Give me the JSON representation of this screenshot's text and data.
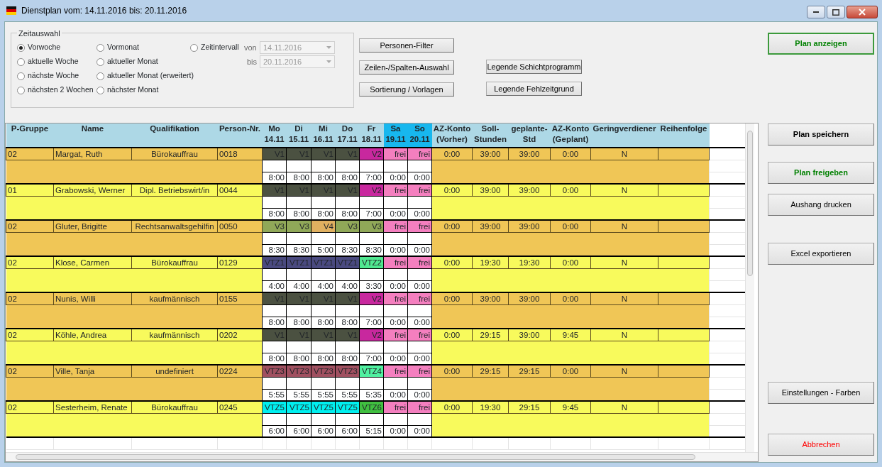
{
  "window": {
    "title": "Dienstplan vom: 14.11.2016 bis: 20.11.2016"
  },
  "time_selection": {
    "legend": "Zeitauswahl",
    "options": [
      {
        "label": "Vorwoche",
        "selected": true
      },
      {
        "label": "aktuelle Woche",
        "selected": false
      },
      {
        "label": "nächste Woche",
        "selected": false
      },
      {
        "label": "nächsten 2 Wochen",
        "selected": false
      },
      {
        "label": "Vormonat",
        "selected": false
      },
      {
        "label": "aktueller Monat",
        "selected": false
      },
      {
        "label": "aktueller Monat (erweitert)",
        "selected": false
      },
      {
        "label": "nächster Monat",
        "selected": false
      },
      {
        "label": "Zeitintervall",
        "selected": false
      }
    ],
    "interval": {
      "from_label": "von",
      "from": "14.11.2016",
      "to_label": "bis",
      "to": "20.11.2016",
      "disabled": true
    }
  },
  "filter_buttons": [
    {
      "label": "Personen-Filter"
    },
    {
      "label": "Zeilen-/Spalten-Auswahl"
    },
    {
      "label": "Sortierung / Vorlagen"
    }
  ],
  "legend_buttons": [
    {
      "label": "Legende Schichtprogramm"
    },
    {
      "label": "Legende Fehlzeitgrund"
    }
  ],
  "side_buttons": [
    {
      "label": "Plan anzeigen",
      "color": "#008000",
      "bold": true,
      "default": true
    },
    {
      "label": "Plan speichern",
      "color": "#000000",
      "bold": true,
      "default": false
    },
    {
      "label": "Plan freigeben",
      "color": "#008000",
      "bold": true,
      "default": false
    },
    {
      "label": "Aushang drucken",
      "color": "#000000",
      "bold": false,
      "default": false
    },
    {
      "label": "Excel exportieren",
      "color": "#000000",
      "bold": false,
      "default": false
    },
    {
      "label": "Einstellungen - Farben",
      "color": "#000000",
      "bold": false,
      "default": false
    },
    {
      "label": "Abbrechen",
      "color": "#ff0000",
      "bold": false,
      "default": false
    }
  ],
  "schedule": {
    "columns": [
      {
        "label": "P-Gruppe"
      },
      {
        "label": "Name"
      },
      {
        "label": "Qualifikation"
      },
      {
        "label": "Person-Nr."
      }
    ],
    "days": [
      {
        "day": "Mo",
        "date": "14.11",
        "weekend": false
      },
      {
        "day": "Di",
        "date": "15.11",
        "weekend": false
      },
      {
        "day": "Mi",
        "date": "16.11",
        "weekend": false
      },
      {
        "day": "Do",
        "date": "17.11",
        "weekend": false
      },
      {
        "day": "Fr",
        "date": "18.11",
        "weekend": false
      },
      {
        "day": "Sa",
        "date": "19.11",
        "weekend": true
      },
      {
        "day": "So",
        "date": "20.11",
        "weekend": true
      }
    ],
    "summary_columns": [
      {
        "label": "AZ-Konto (Vorher)"
      },
      {
        "label": "Soll-Stunden"
      },
      {
        "label": "geplante-Std"
      },
      {
        "label": "AZ-Konto (Geplant)"
      },
      {
        "label": "Geringverdiener"
      },
      {
        "label": "Reihenfolge"
      }
    ],
    "employees": [
      {
        "group": "02",
        "name": "Margat, Ruth",
        "qualification": "Bürokauffrau",
        "number": "0018",
        "color": "#f0c656",
        "shifts": [
          {
            "code": "V1",
            "color": "#4b5141"
          },
          {
            "code": "V1",
            "color": "#4b5141"
          },
          {
            "code": "V1",
            "color": "#4b5141"
          },
          {
            "code": "V1",
            "color": "#4b5141"
          },
          {
            "code": "V2",
            "color": "#c8289e"
          },
          {
            "code": "frei",
            "color": "#f47fbf"
          },
          {
            "code": "frei",
            "color": "#f47fbf"
          }
        ],
        "hours": [
          "8:00",
          "8:00",
          "8:00",
          "8:00",
          "7:00",
          "0:00",
          "0:00"
        ],
        "summary": [
          "0:00",
          "39:00",
          "39:00",
          "0:00",
          "N"
        ]
      },
      {
        "group": "01",
        "name": "Grabowski, Werner",
        "qualification": "Dipl. Betriebswirt/in",
        "number": "0044",
        "color": "#f8fa5c",
        "shifts": [
          {
            "code": "V1",
            "color": "#4b5141"
          },
          {
            "code": "V1",
            "color": "#4b5141"
          },
          {
            "code": "V1",
            "color": "#4b5141"
          },
          {
            "code": "V1",
            "color": "#4b5141"
          },
          {
            "code": "V2",
            "color": "#c8289e"
          },
          {
            "code": "frei",
            "color": "#f47fbf"
          },
          {
            "code": "frei",
            "color": "#f47fbf"
          }
        ],
        "hours": [
          "8:00",
          "8:00",
          "8:00",
          "8:00",
          "7:00",
          "0:00",
          "0:00"
        ],
        "summary": [
          "0:00",
          "39:00",
          "39:00",
          "0:00",
          "N"
        ]
      },
      {
        "group": "02",
        "name": "Gluter, Brigitte",
        "qualification": "Rechtsanwaltsgehilfin",
        "number": "0050",
        "color": "#f0c656",
        "shifts": [
          {
            "code": "V3",
            "color": "#90a858"
          },
          {
            "code": "V3",
            "color": "#90a858"
          },
          {
            "code": "V4",
            "color": "#e0b060"
          },
          {
            "code": "V3",
            "color": "#90a858"
          },
          {
            "code": "V3",
            "color": "#90a858"
          },
          {
            "code": "frei",
            "color": "#f47fbf"
          },
          {
            "code": "frei",
            "color": "#f47fbf"
          }
        ],
        "hours": [
          "8:30",
          "8:30",
          "5:00",
          "8:30",
          "8:30",
          "0:00",
          "0:00"
        ],
        "summary": [
          "0:00",
          "39:00",
          "39:00",
          "0:00",
          "N"
        ]
      },
      {
        "group": "02",
        "name": "Klose, Carmen",
        "qualification": "Bürokauffrau",
        "number": "0129",
        "color": "#f8fa5c",
        "shifts": [
          {
            "code": "VTZ1",
            "color": "#4a4a80"
          },
          {
            "code": "VTZ1",
            "color": "#4a4a80"
          },
          {
            "code": "VTZ1",
            "color": "#4a4a80"
          },
          {
            "code": "VTZ1",
            "color": "#4a4a80"
          },
          {
            "code": "VTZ2",
            "color": "#50e890"
          },
          {
            "code": "frei",
            "color": "#f47fbf"
          },
          {
            "code": "frei",
            "color": "#f47fbf"
          }
        ],
        "hours": [
          "4:00",
          "4:00",
          "4:00",
          "4:00",
          "3:30",
          "0:00",
          "0:00"
        ],
        "summary": [
          "0:00",
          "19:30",
          "19:30",
          "0:00",
          "N"
        ]
      },
      {
        "group": "02",
        "name": "Nunis, Willi",
        "qualification": "kaufmännisch",
        "number": "0155",
        "color": "#f0c656",
        "shifts": [
          {
            "code": "V1",
            "color": "#4b5141"
          },
          {
            "code": "V1",
            "color": "#4b5141"
          },
          {
            "code": "V1",
            "color": "#4b5141"
          },
          {
            "code": "V1",
            "color": "#4b5141"
          },
          {
            "code": "V2",
            "color": "#c8289e"
          },
          {
            "code": "frei",
            "color": "#f47fbf"
          },
          {
            "code": "frei",
            "color": "#f47fbf"
          }
        ],
        "hours": [
          "8:00",
          "8:00",
          "8:00",
          "8:00",
          "7:00",
          "0:00",
          "0:00"
        ],
        "summary": [
          "0:00",
          "39:00",
          "39:00",
          "0:00",
          "N"
        ]
      },
      {
        "group": "02",
        "name": "Köhle, Andrea",
        "qualification": "kaufmännisch",
        "number": "0202",
        "color": "#f8fa5c",
        "shifts": [
          {
            "code": "V1",
            "color": "#4b5141"
          },
          {
            "code": "V1",
            "color": "#4b5141"
          },
          {
            "code": "V1",
            "color": "#4b5141"
          },
          {
            "code": "V1",
            "color": "#4b5141"
          },
          {
            "code": "V2",
            "color": "#c8289e"
          },
          {
            "code": "frei",
            "color": "#f47fbf"
          },
          {
            "code": "frei",
            "color": "#f47fbf"
          }
        ],
        "hours": [
          "8:00",
          "8:00",
          "8:00",
          "8:00",
          "7:00",
          "0:00",
          "0:00"
        ],
        "summary": [
          "0:00",
          "29:15",
          "39:00",
          "9:45",
          "N"
        ]
      },
      {
        "group": "02",
        "name": "Ville, Tanja",
        "qualification": "undefiniert",
        "number": "0224",
        "color": "#f0c656",
        "shifts": [
          {
            "code": "VTZ3",
            "color": "#a05060"
          },
          {
            "code": "VTZ3",
            "color": "#a05060"
          },
          {
            "code": "VTZ3",
            "color": "#a05060"
          },
          {
            "code": "VTZ3",
            "color": "#a05060"
          },
          {
            "code": "VTZ4",
            "color": "#50f0a0"
          },
          {
            "code": "frei",
            "color": "#f47fbf"
          },
          {
            "code": "frei",
            "color": "#f47fbf"
          }
        ],
        "hours": [
          "5:55",
          "5:55",
          "5:55",
          "5:55",
          "5:35",
          "0:00",
          "0:00"
        ],
        "summary": [
          "0:00",
          "29:15",
          "29:15",
          "0:00",
          "N"
        ]
      },
      {
        "group": "02",
        "name": "Sesterheim, Renate",
        "qualification": "Bürokauffrau",
        "number": "0245",
        "color": "#f8fa5c",
        "shifts": [
          {
            "code": "VTZ5",
            "color": "#00f0f0"
          },
          {
            "code": "VTZ5",
            "color": "#00f0f0"
          },
          {
            "code": "VTZ5",
            "color": "#00f0f0"
          },
          {
            "code": "VTZ5",
            "color": "#00f0f0"
          },
          {
            "code": "VTZ6",
            "color": "#40c040"
          },
          {
            "code": "frei",
            "color": "#f47fbf"
          },
          {
            "code": "frei",
            "color": "#f47fbf"
          }
        ],
        "hours": [
          "6:00",
          "6:00",
          "6:00",
          "6:00",
          "5:15",
          "0:00",
          "0:00"
        ],
        "summary": [
          "0:00",
          "19:30",
          "29:15",
          "9:45",
          "N"
        ]
      }
    ]
  }
}
